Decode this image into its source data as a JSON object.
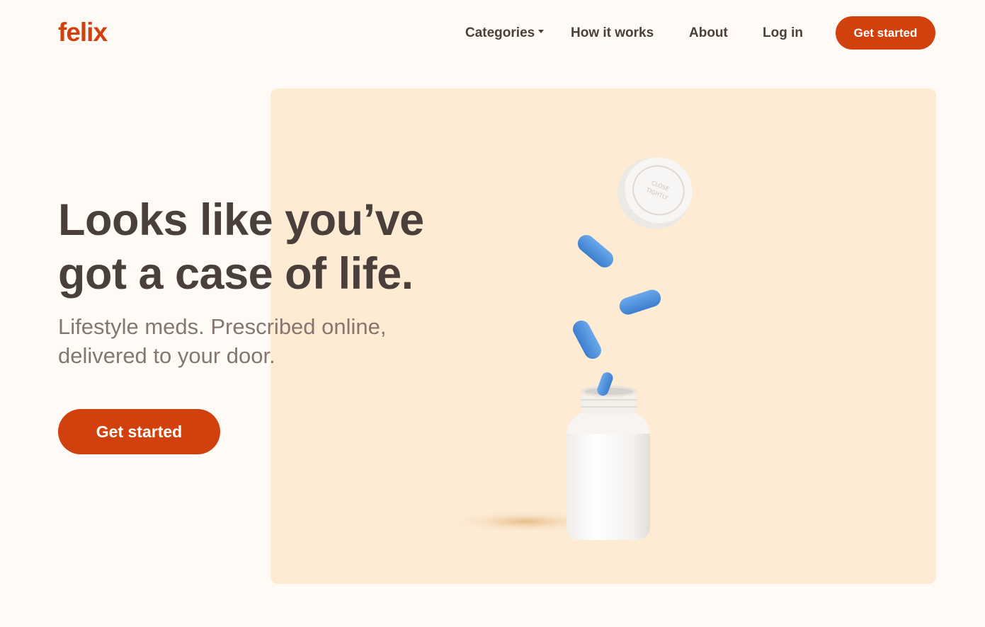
{
  "brand": {
    "logo_text": "felix",
    "accent_color": "#d1410d"
  },
  "nav": {
    "items": [
      {
        "label": "Categories",
        "has_dropdown": true
      },
      {
        "label": "How it works"
      },
      {
        "label": "About"
      },
      {
        "label": "Log in"
      }
    ],
    "cta_label": "Get started"
  },
  "hero": {
    "headline_line1": "Looks like you’ve",
    "headline_line2": "got a case of life.",
    "subhead_line1": "Lifestyle meds. Prescribed online,",
    "subhead_line2": "delivered to your door.",
    "cta_label": "Get started",
    "image": {
      "subject": "open pill bottle with blue pills and floating cap",
      "background_color": "#fdebd4",
      "pill_color": "#4a90d9",
      "cap_text": "PUSH DOWN & TURN · CLOSE TIGHTLY · TO OPEN"
    }
  }
}
